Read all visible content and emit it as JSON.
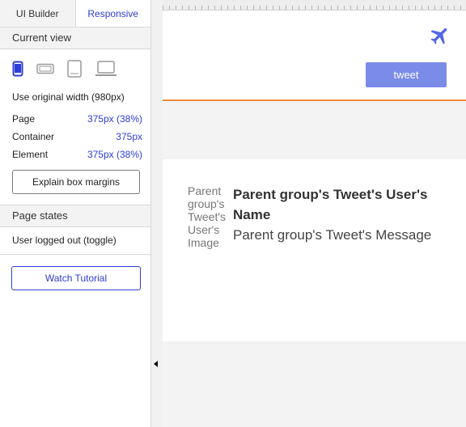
{
  "sidebar": {
    "tabs": [
      {
        "label": "UI Builder"
      },
      {
        "label": "Responsive"
      }
    ],
    "current_view": {
      "heading": "Current view",
      "devices": [
        {
          "icon": "phone-icon",
          "selected": true
        },
        {
          "icon": "phone-landscape-icon",
          "selected": false
        },
        {
          "icon": "tablet-icon",
          "selected": false
        },
        {
          "icon": "laptop-icon",
          "selected": false
        }
      ],
      "original_width_label": "Use original width (980px)",
      "rows": [
        {
          "label": "Page",
          "value": "375px (38%)"
        },
        {
          "label": "Container",
          "value": "375px"
        },
        {
          "label": "Element",
          "value": "375px (38%)"
        }
      ],
      "explain_button": "Explain box margins"
    },
    "page_states": {
      "heading": "Page states",
      "state_label": "User logged out (toggle)"
    },
    "tutorial_button": "Watch Tutorial"
  },
  "canvas": {
    "header": {
      "logo_icon": "airplane-icon",
      "tweet_button": "tweet"
    },
    "tweet_card": {
      "image_placeholder": "Parent group's Tweet's User's Image",
      "user_name": "Parent group's Tweet's User's Name",
      "message": "Parent group's Tweet's Message"
    }
  },
  "colors": {
    "accent_blue": "#2d3ed6",
    "tweet_button": "#7b8be8",
    "header_border": "#f08a3a",
    "logo": "#5468e6"
  }
}
